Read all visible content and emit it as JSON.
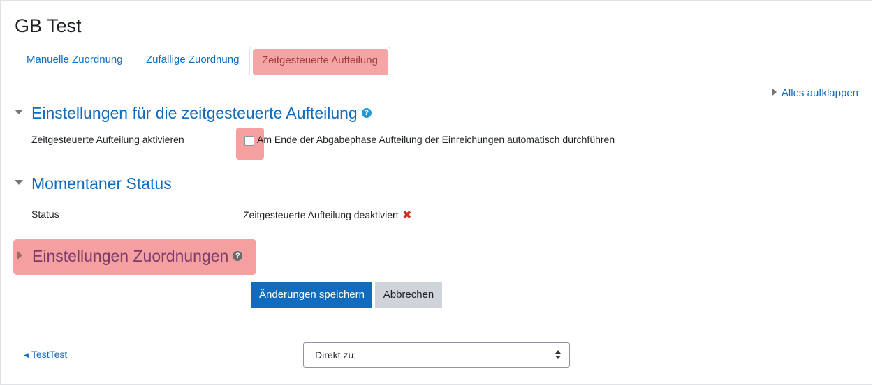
{
  "page": {
    "title": "GB Test"
  },
  "tabs": [
    {
      "label": "Manuelle Zuordnung"
    },
    {
      "label": "Zufällige Zuordnung"
    },
    {
      "label": "Zeitgesteuerte Aufteilung"
    }
  ],
  "expand_all": "Alles aufklappen",
  "section_scheduled": {
    "title": "Einstellungen für die zeitgesteuerte Aufteilung",
    "field_label": "Zeitgesteuerte Aufteilung aktivieren",
    "checkbox_label": "Am Ende der Abgabephase Aufteilung der Einreichungen automatisch durchführen",
    "checked": false,
    "help_icon": "question-circle-icon"
  },
  "section_status": {
    "title": "Momentaner Status",
    "field_label": "Status",
    "value": "Zeitgesteuerte Aufteilung deaktiviert",
    "status_icon": "x-icon"
  },
  "section_allocation": {
    "title": "Einstellungen Zuordnungen",
    "help_icon": "question-circle-icon"
  },
  "buttons": {
    "save": "Änderungen speichern",
    "cancel": "Abbrechen"
  },
  "nav": {
    "prev_link": "TestTest",
    "jump_placeholder": "Direkt zu:"
  },
  "colors": {
    "link": "#0f6cbf",
    "highlight": "#f4a0a0",
    "danger": "#ca3120"
  }
}
